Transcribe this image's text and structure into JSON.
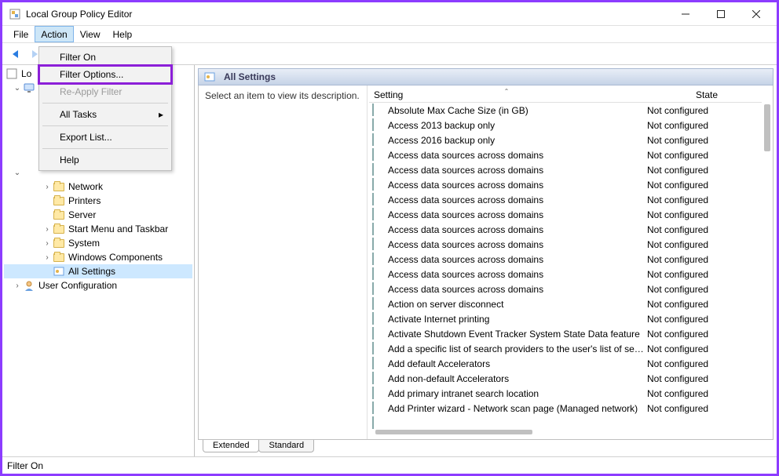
{
  "window": {
    "title": "Local Group Policy Editor"
  },
  "menu": {
    "file": "File",
    "action": "Action",
    "view": "View",
    "help": "Help"
  },
  "action_menu": {
    "filter_on": "Filter On",
    "filter_options": "Filter Options...",
    "reapply": "Re-Apply Filter",
    "all_tasks": "All Tasks",
    "export": "Export List...",
    "help": "Help"
  },
  "tree": {
    "root": "Local Computer Policy",
    "network": "Network",
    "printers": "Printers",
    "server": "Server",
    "start_menu": "Start Menu and Taskbar",
    "system": "System",
    "windows_components": "Windows Components",
    "all_settings": "All Settings",
    "user_config": "User Configuration"
  },
  "detail": {
    "header": "All Settings",
    "description_hint": "Select an item to view its description.",
    "col_setting": "Setting",
    "col_state": "State",
    "tab_extended": "Extended",
    "tab_standard": "Standard"
  },
  "settings": [
    {
      "name": "Absolute Max Cache Size (in GB)",
      "state": "Not configured"
    },
    {
      "name": "Access 2013 backup only",
      "state": "Not configured"
    },
    {
      "name": "Access 2016 backup only",
      "state": "Not configured"
    },
    {
      "name": "Access data sources across domains",
      "state": "Not configured"
    },
    {
      "name": "Access data sources across domains",
      "state": "Not configured"
    },
    {
      "name": "Access data sources across domains",
      "state": "Not configured"
    },
    {
      "name": "Access data sources across domains",
      "state": "Not configured"
    },
    {
      "name": "Access data sources across domains",
      "state": "Not configured"
    },
    {
      "name": "Access data sources across domains",
      "state": "Not configured"
    },
    {
      "name": "Access data sources across domains",
      "state": "Not configured"
    },
    {
      "name": "Access data sources across domains",
      "state": "Not configured"
    },
    {
      "name": "Access data sources across domains",
      "state": "Not configured"
    },
    {
      "name": "Access data sources across domains",
      "state": "Not configured"
    },
    {
      "name": "Action on server disconnect",
      "state": "Not configured"
    },
    {
      "name": "Activate Internet printing",
      "state": "Not configured"
    },
    {
      "name": "Activate Shutdown Event Tracker System State Data feature",
      "state": "Not configured"
    },
    {
      "name": "Add a specific list of search providers to the user's list of sea...",
      "state": "Not configured"
    },
    {
      "name": "Add default Accelerators",
      "state": "Not configured"
    },
    {
      "name": "Add non-default Accelerators",
      "state": "Not configured"
    },
    {
      "name": "Add primary intranet search location",
      "state": "Not configured"
    },
    {
      "name": "Add Printer wizard - Network scan page (Managed network)",
      "state": "Not configured"
    }
  ],
  "status": "Filter On"
}
